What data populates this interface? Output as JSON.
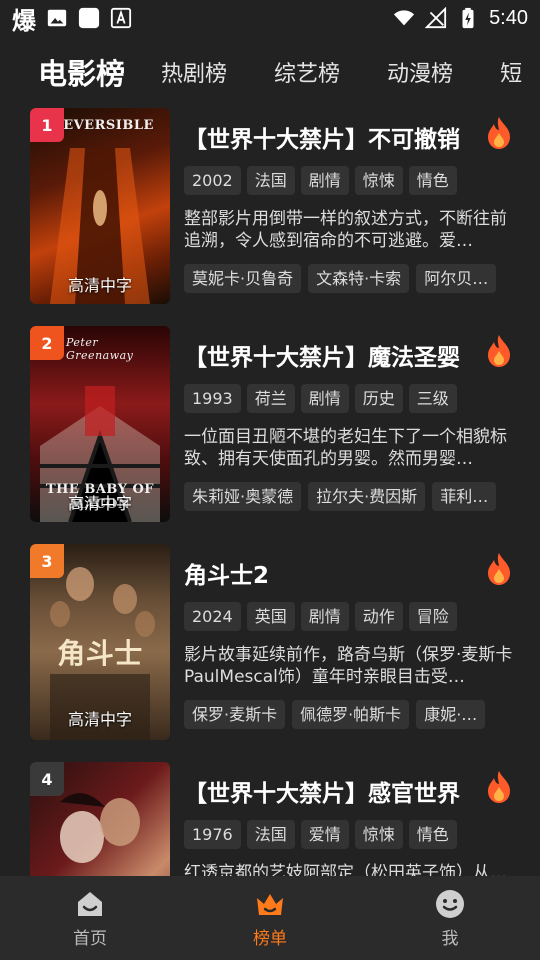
{
  "status_bar": {
    "app_icon_text": "爆",
    "time": "5:40"
  },
  "tabs": [
    {
      "label": "电影榜",
      "active": true
    },
    {
      "label": "热剧榜",
      "active": false
    },
    {
      "label": "综艺榜",
      "active": false
    },
    {
      "label": "动漫榜",
      "active": false
    },
    {
      "label": "短",
      "active": false
    }
  ],
  "list": [
    {
      "rank": "1",
      "rank_color": "#e8334a",
      "title": "【世界十大禁片】不可撤销",
      "tags": [
        "2002",
        "法国",
        "剧情",
        "惊悚",
        "情色"
      ],
      "desc": "整部影片用倒带一样的叙述方式，不断往前追溯，令人感到宿命的不可逃避。爱…",
      "cast": [
        "莫妮卡·贝鲁奇",
        "文森特·卡索",
        "阿尔贝…"
      ],
      "poster_label": "高清中字",
      "poster_text": "IRREVERSIBLE",
      "poster_colors": [
        "#5a1a08",
        "#c2410c",
        "#1a0d05"
      ]
    },
    {
      "rank": "2",
      "rank_color": "#f0541e",
      "title": "【世界十大禁片】魔法圣婴",
      "tags": [
        "1993",
        "荷兰",
        "剧情",
        "历史",
        "三级"
      ],
      "desc": "一位面目丑陋不堪的老妇生下了一个相貌标致、拥有天使面孔的男婴。然而男婴…",
      "cast": [
        "朱莉娅·奥蒙德",
        "拉尔夫·费因斯",
        "菲利…"
      ],
      "poster_label": "高清中字",
      "poster_text": "Peter Greenaway",
      "poster_bottom_text": "THE BABY OF MACON",
      "poster_colors": [
        "#3a0a0a",
        "#8b1a1a",
        "#0d0d0d"
      ]
    },
    {
      "rank": "3",
      "rank_color": "#f07a2a",
      "title": "角斗士2",
      "tags": [
        "2024",
        "英国",
        "剧情",
        "动作",
        "冒险"
      ],
      "desc": "影片故事延续前作，路奇乌斯（保罗·麦斯卡PaulMescal饰）童年时亲眼目击受…",
      "cast": [
        "保罗·麦斯卡",
        "佩德罗·帕斯卡",
        "康妮·…"
      ],
      "poster_label": "高清中字",
      "poster_text": "角斗士",
      "poster_colors": [
        "#4a3524",
        "#8a6a4a",
        "#2a1e14"
      ]
    },
    {
      "rank": "4",
      "rank_color": "#3a3a3a",
      "title": "【世界十大禁片】感官世界",
      "tags": [
        "1976",
        "法国",
        "爱情",
        "惊悚",
        "情色"
      ],
      "desc": "红透京都的艺妓阿部定（松田英子饰）从…",
      "cast": [],
      "poster_label": "",
      "poster_text": "",
      "poster_colors": [
        "#6b1a1a",
        "#c98a6a",
        "#2a1010"
      ]
    }
  ],
  "bottom_nav": [
    {
      "label": "首页",
      "icon": "home-icon",
      "active": false
    },
    {
      "label": "榜单",
      "icon": "crown-icon",
      "active": true
    },
    {
      "label": "我",
      "icon": "smile-icon",
      "active": false
    }
  ],
  "colors": {
    "background": "#222222",
    "accent": "#ff7a1a",
    "tag_bg": "#333333"
  }
}
